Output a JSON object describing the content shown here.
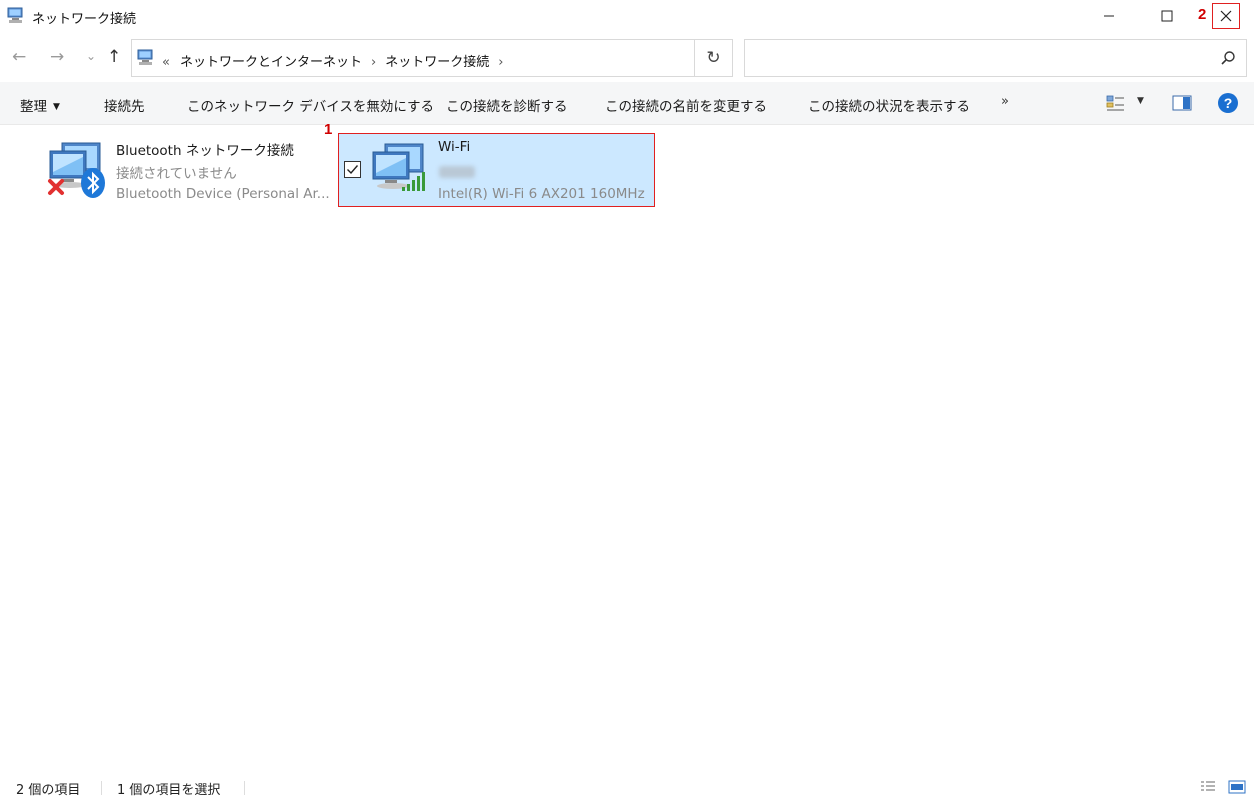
{
  "window": {
    "title": "ネットワーク接続",
    "minimize_glyph": "—",
    "maximize_glyph": "☐",
    "close_glyph": "✕"
  },
  "annotations": {
    "item_marker": "1",
    "close_marker": "2"
  },
  "nav": {
    "back_glyph": "←",
    "forward_glyph": "→",
    "recent_glyph": "⌄",
    "up_glyph": "↑",
    "address_overflow": "«",
    "breadcrumb": [
      "ネットワークとインターネット",
      "ネットワーク接続"
    ],
    "separator": "›",
    "dropdown_glyph": "⌄",
    "refresh_glyph": "↻",
    "search_placeholder": ""
  },
  "commands": {
    "organize": "整理",
    "connect_to": "接続先",
    "disable": "このネットワーク デバイスを無効にする",
    "diagnose": "この接続を診断する",
    "rename": "この接続の名前を変更する",
    "status": "この接続の状況を表示する",
    "more": "»"
  },
  "items": [
    {
      "name": "Bluetooth ネットワーク接続",
      "status": "接続されていません",
      "device": "Bluetooth Device (Personal Ar...",
      "icon": "network-computer-icon",
      "overlay": "red-x-icon",
      "badge": "bluetooth-icon",
      "selected": false
    },
    {
      "name": "Wi-Fi",
      "status": "",
      "device": "Intel(R) Wi-Fi 6 AX201 160MHz",
      "icon": "network-computer-icon",
      "badge": "signal-bars-icon",
      "selected": true
    }
  ],
  "statusbar": {
    "count": "2 個の項目",
    "selected": "1 個の項目を選択"
  },
  "colors": {
    "selection": "#cce8ff",
    "annotation_red": "#d00000",
    "help_blue": "#1a6fd1",
    "signal_green": "#3a9a3a"
  }
}
